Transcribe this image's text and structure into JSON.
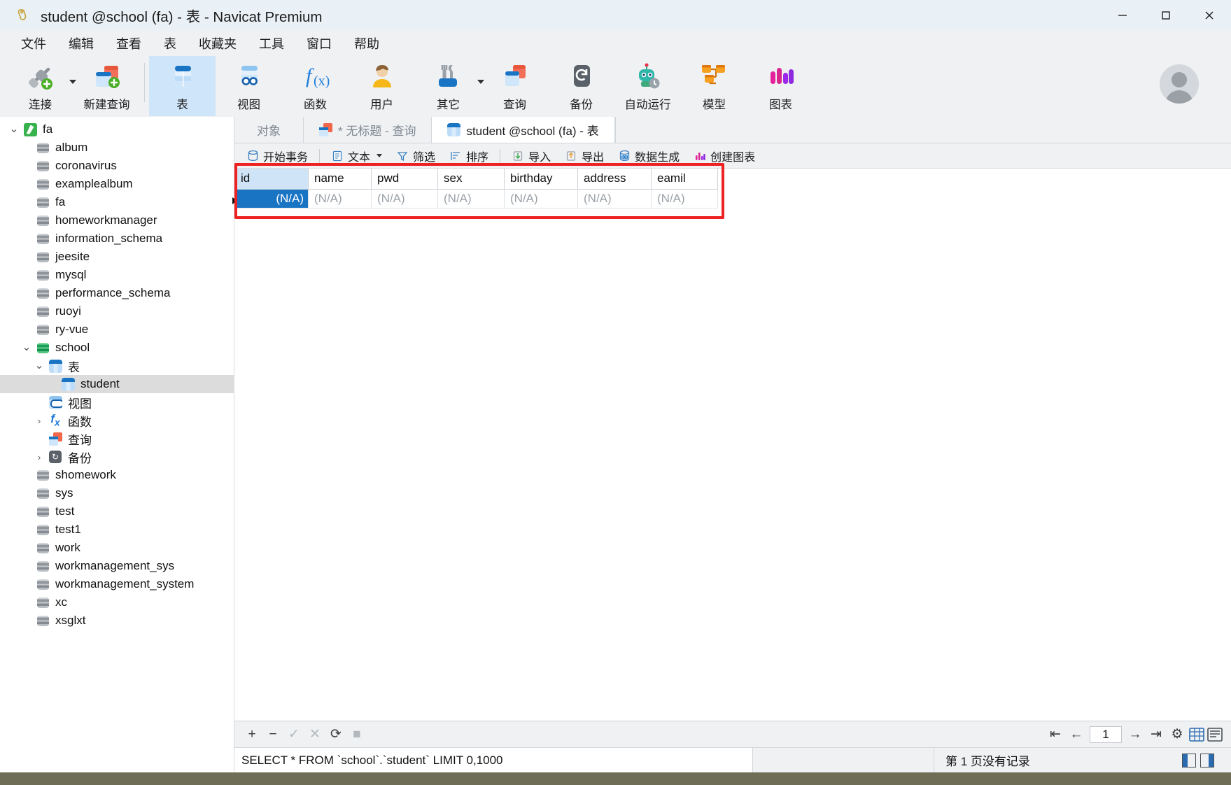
{
  "window": {
    "title": "student @school (fa) - 表 - Navicat Premium",
    "logo_icon": "navicat-logo-icon",
    "minimize_label": "—",
    "maximize_label": "□",
    "close_label": "✕"
  },
  "menubar": {
    "items": [
      {
        "label": "文件",
        "name": "menu-file"
      },
      {
        "label": "编辑",
        "name": "menu-edit"
      },
      {
        "label": "查看",
        "name": "menu-view"
      },
      {
        "label": "表",
        "name": "menu-table"
      },
      {
        "label": "收藏夹",
        "name": "menu-favorites"
      },
      {
        "label": "工具",
        "name": "menu-tools"
      },
      {
        "label": "窗口",
        "name": "menu-window"
      },
      {
        "label": "帮助",
        "name": "menu-help"
      }
    ]
  },
  "toolbar": {
    "items": [
      {
        "label": "连接",
        "icon": "connection-plug-icon",
        "active": false,
        "has_caret": true
      },
      {
        "label": "新建查询",
        "icon": "new-query-icon",
        "active": false,
        "has_caret": false
      },
      {
        "label": "表",
        "icon": "table-icon",
        "active": true,
        "has_caret": false
      },
      {
        "label": "视图",
        "icon": "view-icon",
        "active": false,
        "has_caret": false
      },
      {
        "label": "函数",
        "icon": "function-fx-icon",
        "active": false,
        "has_caret": false
      },
      {
        "label": "用户",
        "icon": "user-icon",
        "active": false,
        "has_caret": false
      },
      {
        "label": "其它",
        "icon": "other-tools-icon",
        "active": false,
        "has_caret": true
      },
      {
        "label": "查询",
        "icon": "query-icon",
        "active": false,
        "has_caret": false
      },
      {
        "label": "备份",
        "icon": "backup-icon",
        "active": false,
        "has_caret": false
      },
      {
        "label": "自动运行",
        "icon": "automation-robot-icon",
        "active": false,
        "has_caret": false
      },
      {
        "label": "模型",
        "icon": "model-icon",
        "active": false,
        "has_caret": false
      },
      {
        "label": "图表",
        "icon": "chart-icon",
        "active": false,
        "has_caret": false
      }
    ],
    "avatar_name": "user-avatar"
  },
  "sidebar": {
    "tree": [
      {
        "label": "fa",
        "icon": "navicat-connection-icon",
        "indent": 0,
        "twisty": "down",
        "selected": false
      },
      {
        "label": "album",
        "icon": "database-icon",
        "indent": 1,
        "twisty": "",
        "selected": false
      },
      {
        "label": "coronavirus",
        "icon": "database-icon",
        "indent": 1,
        "twisty": "",
        "selected": false
      },
      {
        "label": "examplealbum",
        "icon": "database-icon",
        "indent": 1,
        "twisty": "",
        "selected": false
      },
      {
        "label": "fa",
        "icon": "database-icon",
        "indent": 1,
        "twisty": "",
        "selected": false
      },
      {
        "label": "homeworkmanager",
        "icon": "database-icon",
        "indent": 1,
        "twisty": "",
        "selected": false
      },
      {
        "label": "information_schema",
        "icon": "database-icon",
        "indent": 1,
        "twisty": "",
        "selected": false
      },
      {
        "label": "jeesite",
        "icon": "database-icon",
        "indent": 1,
        "twisty": "",
        "selected": false
      },
      {
        "label": "mysql",
        "icon": "database-icon",
        "indent": 1,
        "twisty": "",
        "selected": false
      },
      {
        "label": "performance_schema",
        "icon": "database-icon",
        "indent": 1,
        "twisty": "",
        "selected": false
      },
      {
        "label": "ruoyi",
        "icon": "database-icon",
        "indent": 1,
        "twisty": "",
        "selected": false
      },
      {
        "label": "ry-vue",
        "icon": "database-icon",
        "indent": 1,
        "twisty": "",
        "selected": false
      },
      {
        "label": "school",
        "icon": "database-open-icon",
        "indent": 1,
        "twisty": "down",
        "selected": false
      },
      {
        "label": "表",
        "icon": "table-folder-icon",
        "indent": 2,
        "twisty": "down",
        "selected": false
      },
      {
        "label": "student",
        "icon": "table-icon",
        "indent": 3,
        "twisty": "",
        "selected": true
      },
      {
        "label": "视图",
        "icon": "view-folder-icon",
        "indent": 2,
        "twisty": "",
        "selected": false
      },
      {
        "label": "函数",
        "icon": "function-fx-icon",
        "indent": 2,
        "twisty": "right",
        "selected": false
      },
      {
        "label": "查询",
        "icon": "query-icon",
        "indent": 2,
        "twisty": "",
        "selected": false
      },
      {
        "label": "备份",
        "icon": "backup-icon",
        "indent": 2,
        "twisty": "right",
        "selected": false
      },
      {
        "label": "shomework",
        "icon": "database-icon",
        "indent": 1,
        "twisty": "",
        "selected": false
      },
      {
        "label": "sys",
        "icon": "database-icon",
        "indent": 1,
        "twisty": "",
        "selected": false
      },
      {
        "label": "test",
        "icon": "database-icon",
        "indent": 1,
        "twisty": "",
        "selected": false
      },
      {
        "label": "test1",
        "icon": "database-icon",
        "indent": 1,
        "twisty": "",
        "selected": false
      },
      {
        "label": "work",
        "icon": "database-icon",
        "indent": 1,
        "twisty": "",
        "selected": false
      },
      {
        "label": "workmanagement_sys",
        "icon": "database-icon",
        "indent": 1,
        "twisty": "",
        "selected": false
      },
      {
        "label": "workmanagement_system",
        "icon": "database-icon",
        "indent": 1,
        "twisty": "",
        "selected": false
      },
      {
        "label": "xc",
        "icon": "database-icon",
        "indent": 1,
        "twisty": "",
        "selected": false
      },
      {
        "label": "xsglxt",
        "icon": "database-icon",
        "indent": 1,
        "twisty": "",
        "selected": false
      }
    ]
  },
  "tabs": [
    {
      "label": "对象",
      "icon": "",
      "active": false
    },
    {
      "label": "* 无标题 - 查询",
      "icon": "query-icon",
      "active": false
    },
    {
      "label": "student @school (fa) - 表",
      "icon": "table-icon",
      "active": true
    }
  ],
  "grid_toolbar": [
    {
      "label": "开始事务",
      "icon": "transaction-icon",
      "caret": false
    },
    {
      "label": "文本",
      "icon": "text-icon",
      "caret": true
    },
    {
      "label": "筛选",
      "icon": "filter-icon",
      "caret": false
    },
    {
      "label": "排序",
      "icon": "sort-icon",
      "caret": false
    },
    {
      "label": "导入",
      "icon": "import-icon",
      "caret": false
    },
    {
      "label": "导出",
      "icon": "export-icon",
      "caret": false
    },
    {
      "label": "数据生成",
      "icon": "data-generate-icon",
      "caret": false
    },
    {
      "label": "创建图表",
      "icon": "create-chart-icon",
      "caret": false
    }
  ],
  "grid": {
    "columns": [
      "id",
      "name",
      "pwd",
      "sex",
      "birthday",
      "address",
      "eamil"
    ],
    "highlighted_column": "id",
    "rows": [
      {
        "cells": [
          "(N/A)",
          "(N/A)",
          "(N/A)",
          "(N/A)",
          "(N/A)",
          "(N/A)",
          "(N/A)"
        ],
        "selected_cell": 0
      }
    ],
    "annotation_color": "#ee2222"
  },
  "grid_footer": {
    "add_label": "+",
    "remove_label": "−",
    "confirm_label": "✓",
    "cancel_label": "✕",
    "refresh_label": "⟳",
    "stop_label": "■",
    "first_page_label": "⇤",
    "prev_page_label": "←",
    "page_value": "1",
    "next_page_label": "→",
    "last_page_label": "⇥",
    "settings_label": "⚙",
    "grid_view_icon": "grid-view-icon",
    "form_view_icon": "form-view-icon"
  },
  "statusbar": {
    "sql": "SELECT * FROM `school`.`student` LIMIT 0,1000",
    "message": "第 1 页没有记录"
  }
}
